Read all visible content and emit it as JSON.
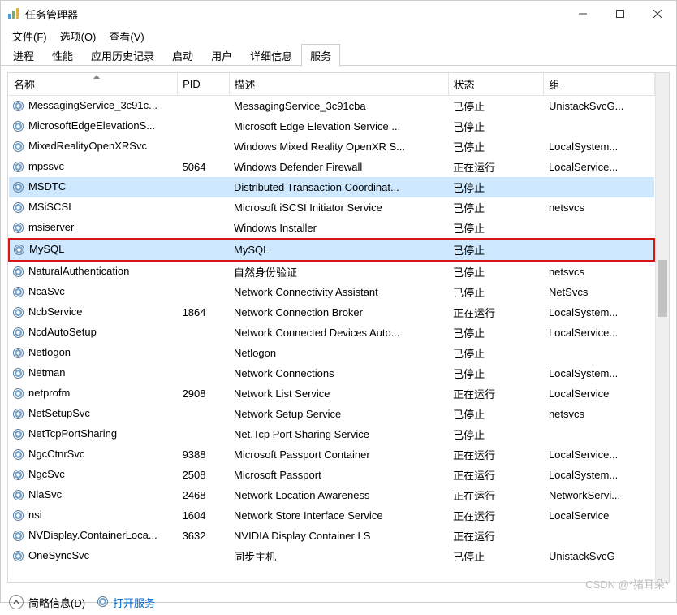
{
  "window": {
    "title": "任务管理器"
  },
  "menubar": {
    "items": [
      {
        "label": "文件(F)"
      },
      {
        "label": "选项(O)"
      },
      {
        "label": "查看(V)"
      }
    ]
  },
  "tabs": {
    "items": [
      {
        "label": "进程",
        "active": false
      },
      {
        "label": "性能",
        "active": false
      },
      {
        "label": "应用历史记录",
        "active": false
      },
      {
        "label": "启动",
        "active": false
      },
      {
        "label": "用户",
        "active": false
      },
      {
        "label": "详细信息",
        "active": false
      },
      {
        "label": "服务",
        "active": true
      }
    ]
  },
  "columns": {
    "name": "名称",
    "pid": "PID",
    "desc": "描述",
    "status": "状态",
    "group": "组"
  },
  "rows": [
    {
      "name": "MessagingService_3c91c...",
      "pid": "",
      "desc": "MessagingService_3c91cba",
      "status": "已停止",
      "group": "UnistackSvcG..."
    },
    {
      "name": "MicrosoftEdgeElevationS...",
      "pid": "",
      "desc": "Microsoft Edge Elevation Service ...",
      "status": "已停止",
      "group": ""
    },
    {
      "name": "MixedRealityOpenXRSvc",
      "pid": "",
      "desc": "Windows Mixed Reality OpenXR S...",
      "status": "已停止",
      "group": "LocalSystem..."
    },
    {
      "name": "mpssvc",
      "pid": "5064",
      "desc": "Windows Defender Firewall",
      "status": "正在运行",
      "group": "LocalService..."
    },
    {
      "name": "MSDTC",
      "pid": "",
      "desc": "Distributed Transaction Coordinat...",
      "status": "已停止",
      "group": "",
      "selected": true
    },
    {
      "name": "MSiSCSI",
      "pid": "",
      "desc": "Microsoft iSCSI Initiator Service",
      "status": "已停止",
      "group": "netsvcs"
    },
    {
      "name": "msiserver",
      "pid": "",
      "desc": "Windows Installer",
      "status": "已停止",
      "group": ""
    },
    {
      "name": "MySQL",
      "pid": "",
      "desc": "MySQL",
      "status": "已停止",
      "group": "",
      "highlighted": true
    },
    {
      "name": "NaturalAuthentication",
      "pid": "",
      "desc": "自然身份验证",
      "status": "已停止",
      "group": "netsvcs"
    },
    {
      "name": "NcaSvc",
      "pid": "",
      "desc": "Network Connectivity Assistant",
      "status": "已停止",
      "group": "NetSvcs"
    },
    {
      "name": "NcbService",
      "pid": "1864",
      "desc": "Network Connection Broker",
      "status": "正在运行",
      "group": "LocalSystem..."
    },
    {
      "name": "NcdAutoSetup",
      "pid": "",
      "desc": "Network Connected Devices Auto...",
      "status": "已停止",
      "group": "LocalService..."
    },
    {
      "name": "Netlogon",
      "pid": "",
      "desc": "Netlogon",
      "status": "已停止",
      "group": ""
    },
    {
      "name": "Netman",
      "pid": "",
      "desc": "Network Connections",
      "status": "已停止",
      "group": "LocalSystem..."
    },
    {
      "name": "netprofm",
      "pid": "2908",
      "desc": "Network List Service",
      "status": "正在运行",
      "group": "LocalService"
    },
    {
      "name": "NetSetupSvc",
      "pid": "",
      "desc": "Network Setup Service",
      "status": "已停止",
      "group": "netsvcs"
    },
    {
      "name": "NetTcpPortSharing",
      "pid": "",
      "desc": "Net.Tcp Port Sharing Service",
      "status": "已停止",
      "group": ""
    },
    {
      "name": "NgcCtnrSvc",
      "pid": "9388",
      "desc": "Microsoft Passport Container",
      "status": "正在运行",
      "group": "LocalService..."
    },
    {
      "name": "NgcSvc",
      "pid": "2508",
      "desc": "Microsoft Passport",
      "status": "正在运行",
      "group": "LocalSystem..."
    },
    {
      "name": "NlaSvc",
      "pid": "2468",
      "desc": "Network Location Awareness",
      "status": "正在运行",
      "group": "NetworkServi..."
    },
    {
      "name": "nsi",
      "pid": "1604",
      "desc": "Network Store Interface Service",
      "status": "正在运行",
      "group": "LocalService"
    },
    {
      "name": "NVDisplay.ContainerLoca...",
      "pid": "3632",
      "desc": "NVIDIA Display Container LS",
      "status": "正在运行",
      "group": ""
    },
    {
      "name": "OneSyncSvc",
      "pid": "",
      "desc": "同步主机",
      "status": "已停止",
      "group": "UnistackSvcG"
    }
  ],
  "footer": {
    "less_details": "简略信息(D)",
    "open_services": "打开服务"
  },
  "watermark": "CSDN @*猪耳朵*"
}
